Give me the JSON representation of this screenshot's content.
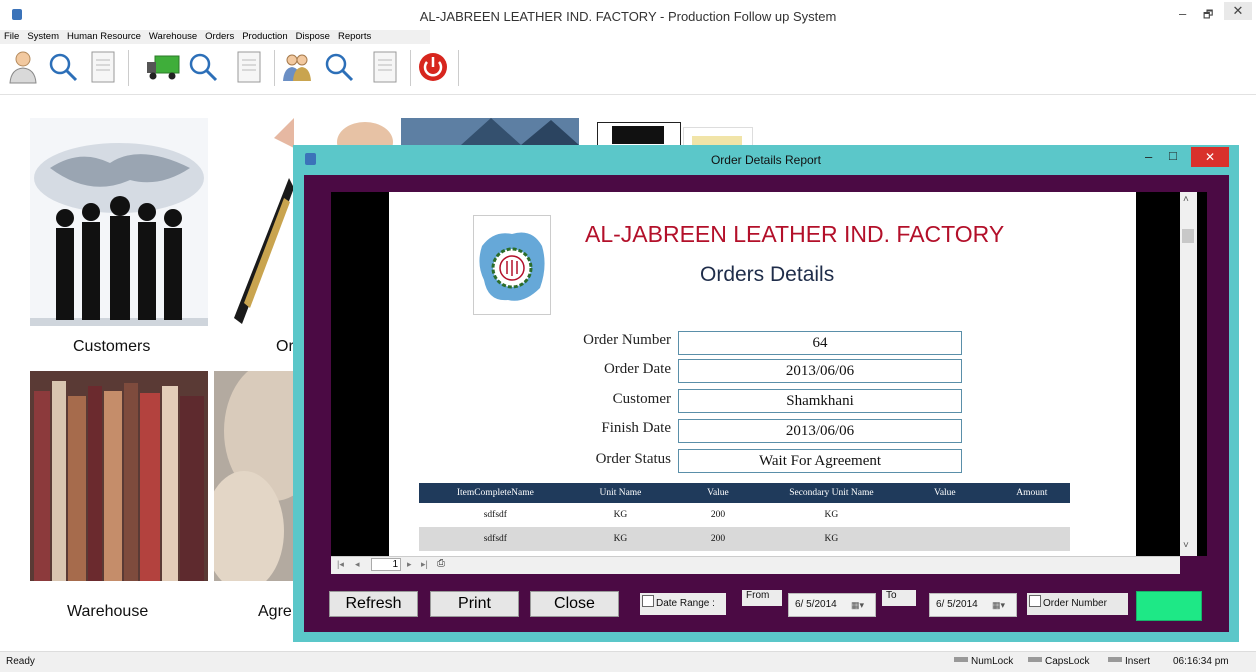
{
  "window": {
    "title": "AL-JABREEN LEATHER IND. FACTORY - Production Follow up System",
    "controls": {
      "minimize": "–",
      "restore": "🗗",
      "close": "✕"
    }
  },
  "menu": [
    "File",
    "System",
    "Human Resource",
    "Warehouse",
    "Orders",
    "Production",
    "Dispose",
    "Reports"
  ],
  "toolbar_icons": [
    "person-icon",
    "magnifier-icon",
    "document-icon",
    "truck-icon",
    "magnifier-icon",
    "document-icon",
    "people-icon",
    "magnifier-icon",
    "document-icon",
    "power-icon"
  ],
  "tiles": {
    "customers": "Customers",
    "orders": "Or",
    "warehouse": "Warehouse",
    "agreement": "Agre"
  },
  "dialog": {
    "title": "Order Details Report",
    "controls": {
      "minimize": "–",
      "restore": "□",
      "close": "✕"
    }
  },
  "report": {
    "company": "AL-JABREEN LEATHER IND. FACTORY",
    "subtitle": "Orders Details",
    "fields": [
      {
        "label": "Order Number",
        "value": "64"
      },
      {
        "label": "Order Date",
        "value": "2013/06/06"
      },
      {
        "label": "Customer",
        "value": "Shamkhani"
      },
      {
        "label": "Finish Date",
        "value": "2013/06/06"
      },
      {
        "label": "Order Status",
        "value": "Wait For Agreement"
      }
    ],
    "columns": [
      "ItemCompleteName",
      "Unit Name",
      "Value",
      "Secondary Unit Name",
      "Value",
      "Amount"
    ],
    "rows": [
      [
        "sdfsdf",
        "KG",
        "200",
        "KG",
        "",
        ""
      ],
      [
        "sdfsdf",
        "KG",
        "200",
        "KG",
        "",
        ""
      ]
    ]
  },
  "nav": {
    "page": "1"
  },
  "buttons": {
    "refresh": "Refresh",
    "print": "Print",
    "close": "Close"
  },
  "filters": {
    "date_range": "Date Range :",
    "from_label": "From",
    "from_date": "6/ 5/2014",
    "to_label": "To",
    "to_date": "6/ 5/2014",
    "order_number": "Order Number"
  },
  "status": {
    "ready": "Ready",
    "numlock": "NumLock",
    "capslock": "CapsLock",
    "insert": "Insert",
    "time": "06:16:34 pm"
  },
  "colors": {
    "dialog_frame": "#5bc7c9",
    "dialog_body": "#4b0a44",
    "company_red": "#b3102a",
    "table_header": "#1f3a5b",
    "indicator_green": "#1ee886"
  }
}
